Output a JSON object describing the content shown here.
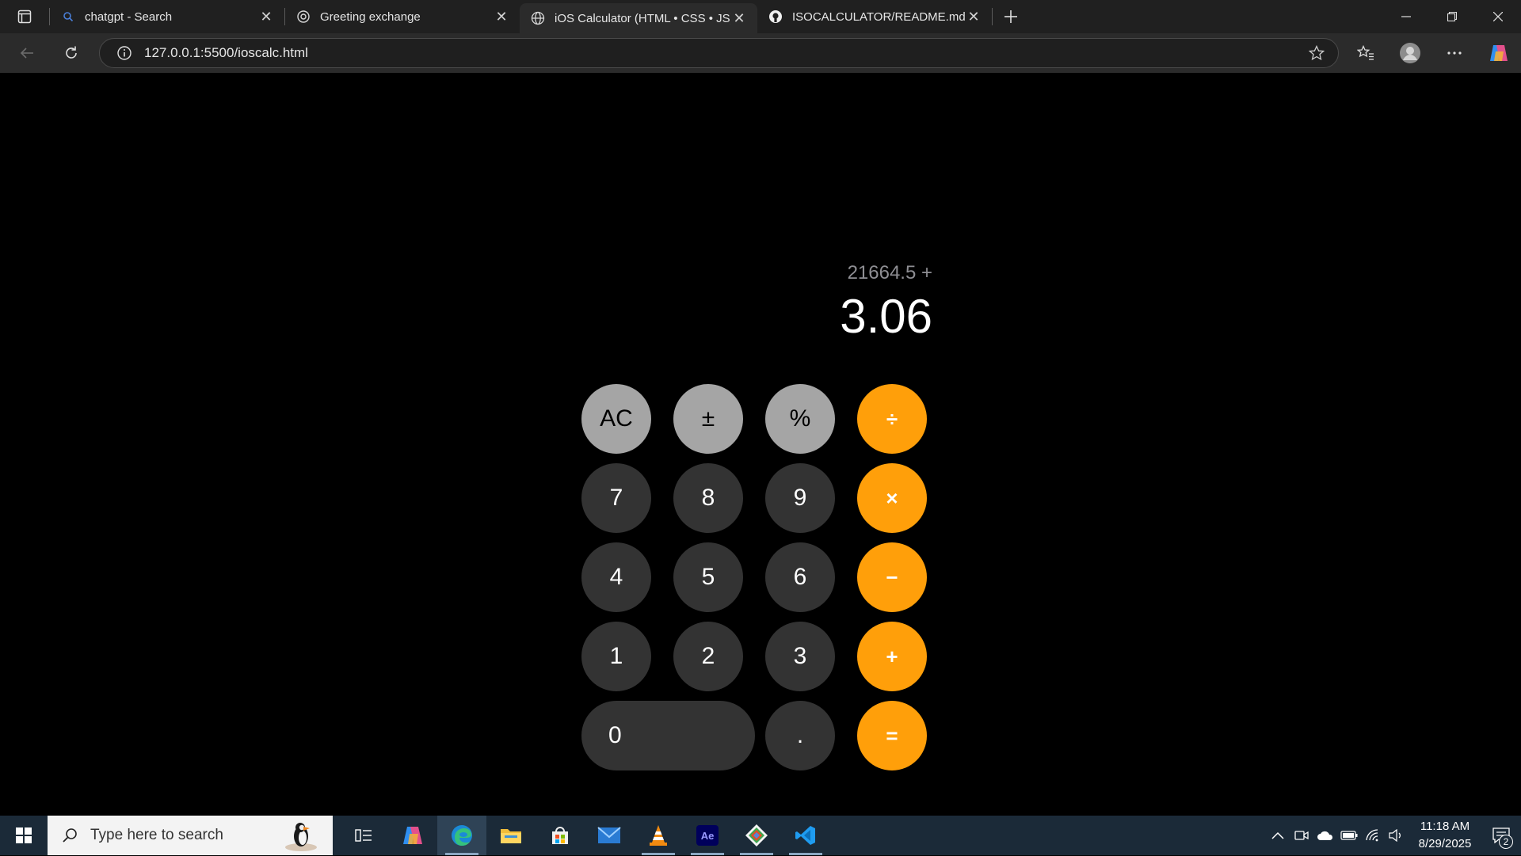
{
  "browser": {
    "tabs": [
      {
        "title": "chatgpt - Search",
        "icon": "search-icon"
      },
      {
        "title": "Greeting exchange",
        "icon": "chatgpt-icon"
      },
      {
        "title": "iOS Calculator (HTML • CSS • JS)",
        "icon": "globe-icon"
      },
      {
        "title": "ISOCALCULATOR/README.md at m",
        "icon": "github-icon"
      }
    ],
    "active_tab": 2,
    "url": "127.0.0.1:5500/ioscalc.html"
  },
  "calculator": {
    "expression": "21664.5 +",
    "current": "3.06",
    "keys": {
      "ac": "AC",
      "plus_minus": "±",
      "percent": "%",
      "divide": "÷",
      "seven": "7",
      "eight": "8",
      "nine": "9",
      "multiply": "×",
      "four": "4",
      "five": "5",
      "six": "6",
      "minus": "−",
      "one": "1",
      "two": "2",
      "three": "3",
      "plus": "+",
      "zero": "0",
      "decimal": ".",
      "equals": "="
    },
    "colors": {
      "function_key": "#a5a5a5",
      "number_key": "#333333",
      "operator_key": "#ff9f0a"
    }
  },
  "taskbar": {
    "search_placeholder": "Type here to search",
    "time": "11:18 AM",
    "date": "8/29/2025",
    "notification_count": "2"
  }
}
